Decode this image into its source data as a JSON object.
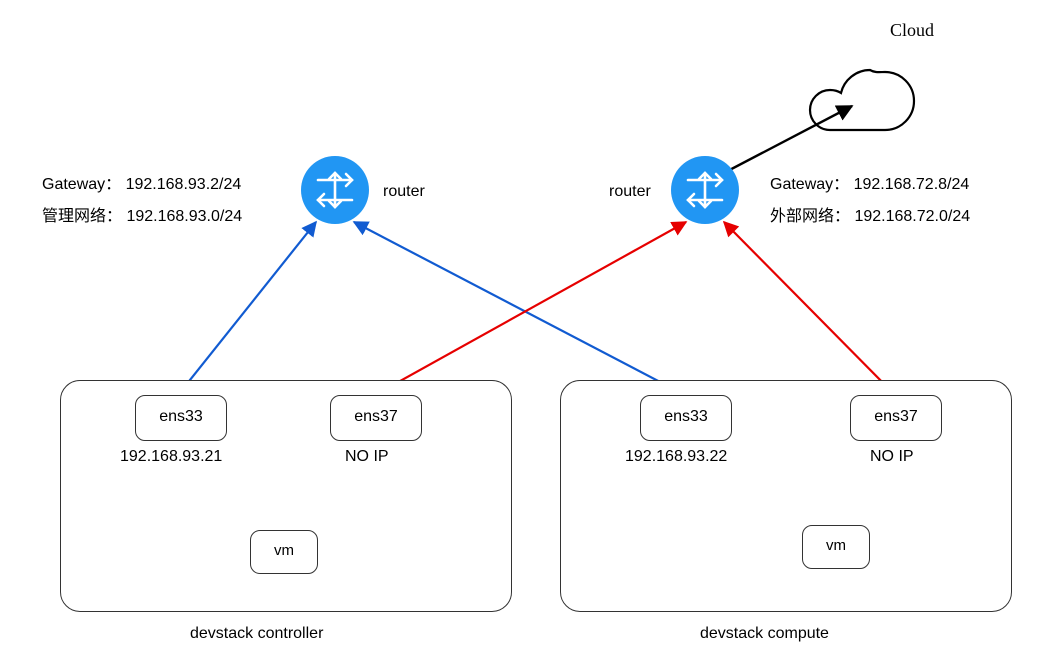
{
  "cloud": {
    "label": "Cloud"
  },
  "routers": {
    "left": {
      "label": "router",
      "gateway_label": "Gateway：",
      "gateway_value": "192.168.93.2/24",
      "net_label": "管理网络：",
      "net_value": "192.168.93.0/24"
    },
    "right": {
      "label": "router",
      "gateway_label": "Gateway：",
      "gateway_value": "192.168.72.8/24",
      "net_label": "外部网络：",
      "net_value": "192.168.72.0/24"
    }
  },
  "nodes": {
    "controller": {
      "caption": "devstack controller",
      "iface1": {
        "name": "ens33",
        "ip": "192.168.93.21"
      },
      "iface2": {
        "name": "ens37",
        "ip": "NO IP"
      },
      "vm": "vm"
    },
    "compute": {
      "caption": "devstack compute",
      "iface1": {
        "name": "ens33",
        "ip": "192.168.93.22"
      },
      "iface2": {
        "name": "ens37",
        "ip": "NO IP"
      },
      "vm": "vm"
    }
  },
  "colors": {
    "router": "#2196f3",
    "blue_line": "#115bd1",
    "red_line": "#e60000"
  }
}
